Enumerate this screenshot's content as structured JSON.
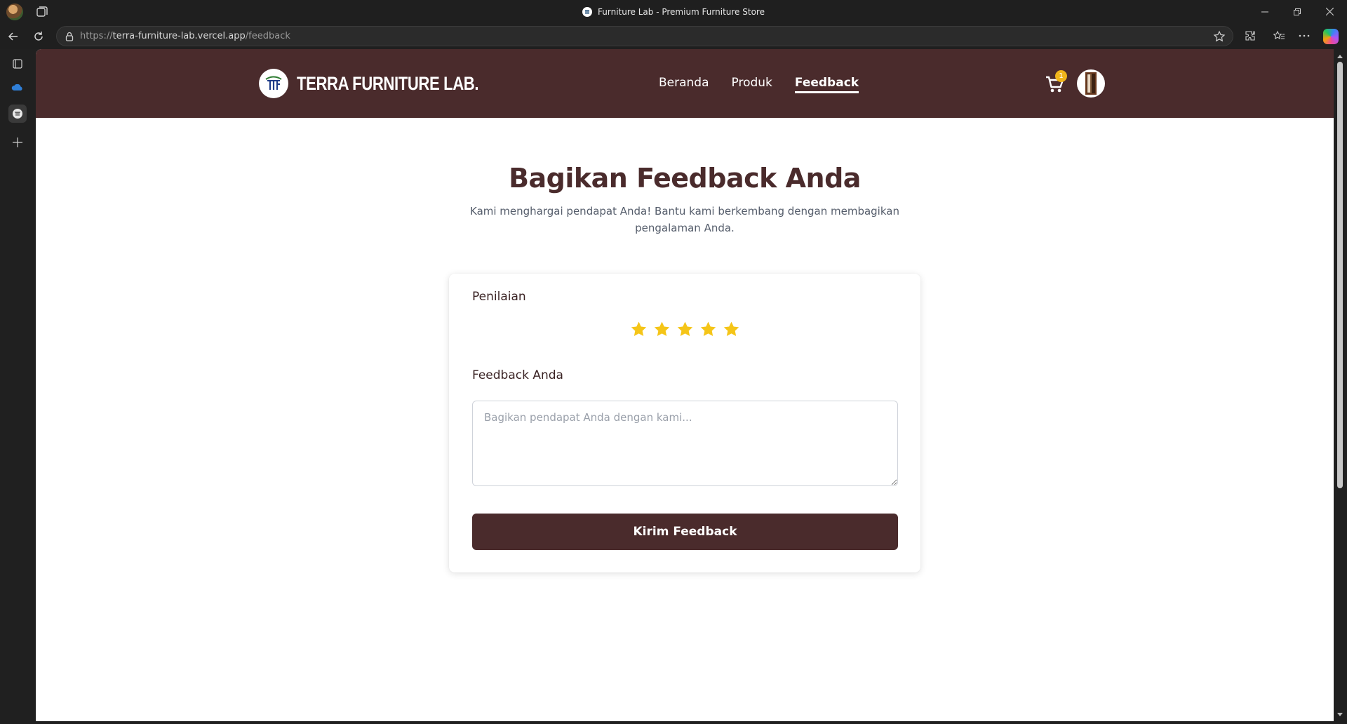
{
  "browser": {
    "tab_title": "Furniture Lab - Premium Furniture Store",
    "url_prefix": "https://",
    "url_domain": "terra-furniture-lab.vercel.app",
    "url_path": "/feedback"
  },
  "header": {
    "logo_text": "TERRA FURNITURE LAB.",
    "nav": [
      {
        "label": "Beranda",
        "active": false
      },
      {
        "label": "Produk",
        "active": false
      },
      {
        "label": "Feedback",
        "active": true
      }
    ],
    "cart_count": "1",
    "brand_color": "#4a2b2c"
  },
  "main": {
    "title": "Bagikan Feedback Anda",
    "subtitle": "Kami menghargai pendapat Anda! Bantu kami berkembang dengan membagikan pengalaman Anda."
  },
  "form": {
    "rating_label": "Penilaian",
    "rating": {
      "value": 5,
      "max": 5,
      "star_color": "#f5c518"
    },
    "feedback_label": "Feedback Anda",
    "feedback_placeholder": "Bagikan pendapat Anda dengan kami...",
    "feedback_value": "",
    "submit_label": "Kirim Feedback"
  }
}
